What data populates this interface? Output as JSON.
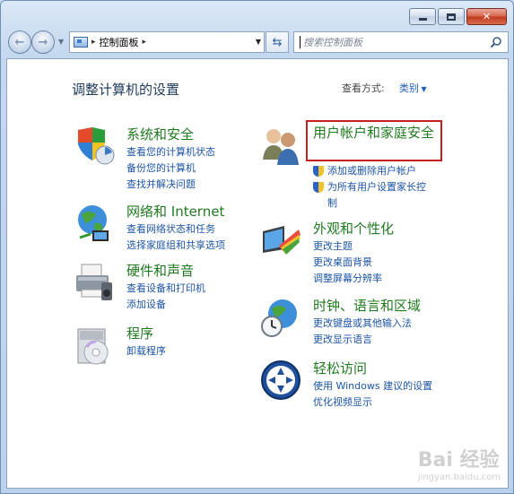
{
  "window": {
    "minimize": "–",
    "maximize": "□",
    "close": "✕"
  },
  "navbar": {
    "address_path": "控制面板",
    "address_sep": "▸",
    "search_placeholder": "搜索控制面板"
  },
  "header": {
    "title": "调整计算机的设置",
    "view_by_label": "查看方式:",
    "view_by_value": "类别"
  },
  "categories_left": [
    {
      "title": "系统和安全",
      "icon": "system-security-shield-icon",
      "links": [
        "查看您的计算机状态",
        "备份您的计算机",
        "查找并解决问题"
      ]
    },
    {
      "title": "网络和 Internet",
      "icon": "network-globe-icon",
      "links": [
        "查看网络状态和任务",
        "选择家庭组和共享选项"
      ]
    },
    {
      "title": "硬件和声音",
      "icon": "printer-hardware-icon",
      "links": [
        "查看设备和打印机",
        "添加设备"
      ]
    },
    {
      "title": "程序",
      "icon": "programs-disc-icon",
      "links": [
        "卸载程序"
      ]
    }
  ],
  "categories_right": [
    {
      "title": "用户帐户和家庭安全",
      "icon": "user-accounts-icon",
      "links": [
        "添加或删除用户帐户",
        "为所有用户设置家长控制"
      ]
    },
    {
      "title": "外观和个性化",
      "icon": "appearance-monitor-icon",
      "links": [
        "更改主题",
        "更改桌面背景",
        "调整屏幕分辨率"
      ]
    },
    {
      "title": "时钟、语言和区域",
      "icon": "clock-globe-icon",
      "links": [
        "更改键盘或其他输入法",
        "更改显示语言"
      ]
    },
    {
      "title": "轻松访问",
      "icon": "ease-of-access-icon",
      "links": [
        "使用 Windows 建议的设置",
        "优化视频显示"
      ]
    }
  ],
  "watermark": {
    "text": "Bai 经验",
    "sub": "jingyan.baidu.com"
  },
  "colors": {
    "category_title": "#1f7a1f",
    "link": "#1c55a4",
    "highlight": "#c2221b"
  }
}
